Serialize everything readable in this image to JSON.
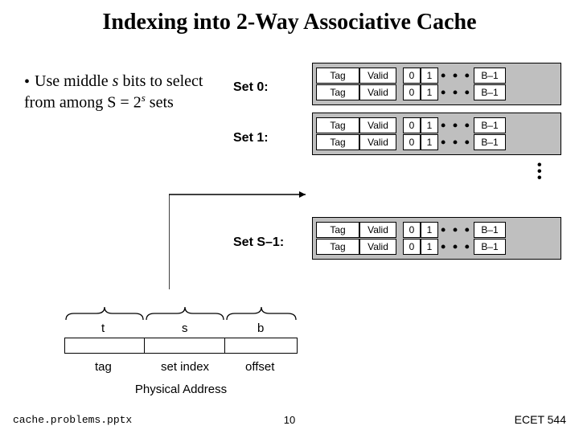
{
  "title": "Indexing into 2-Way Associative Cache",
  "bullet": {
    "prefix": "Use middle ",
    "s": "s",
    "mid": " bits to select from among S = 2",
    "exp": "s",
    "suffix": " sets"
  },
  "set_labels": [
    "Set 0:",
    "Set 1:",
    "Set S–1:"
  ],
  "line": {
    "tag": "Tag",
    "valid": "Valid",
    "c0": "0",
    "c1": "1",
    "dots": "• • •",
    "bm1": "B–1"
  },
  "addr": {
    "t": "t",
    "s": "s",
    "b": "b",
    "tag": "tag",
    "setindex": "set index",
    "offset": "offset",
    "pa": "Physical Address"
  },
  "footer": {
    "left": "cache.problems.pptx",
    "mid": "10",
    "right": "ECET 544"
  }
}
